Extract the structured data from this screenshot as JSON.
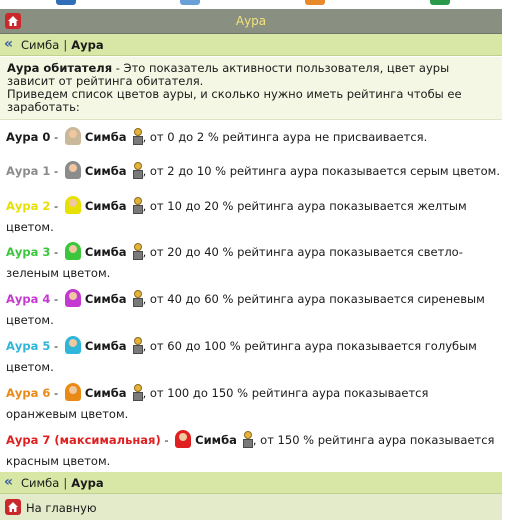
{
  "header": {
    "title": "Аура"
  },
  "breadcrumb": {
    "parent": "Симба",
    "separator": "|",
    "current": "Аура"
  },
  "intro": {
    "term": "Аура обитателя",
    "definition": " - Это показатель активности пользователя, цвет ауры зависит от рейтинга обитателя.",
    "lead": "Приведем список цветов ауры, и сколько нужно иметь рейтинга чтобы ее заработать:"
  },
  "user": {
    "name": "Симба"
  },
  "levels": [
    {
      "label": "Аура 0",
      "color": "#1a1a1a",
      "line1": ", от 0 до 2 % рейтинга аура не присваивается.",
      "line2": ""
    },
    {
      "label": "Аура 1",
      "color": "#8c8c8c",
      "line1": ", от 2 до 10 % рейтинга аура показывается серым цветом.",
      "line2": ""
    },
    {
      "label": "Аура 2",
      "color": "#e8e000",
      "line1": ", от 10 до 20 % рейтинга аура показывается желтым",
      "line2": "цветом."
    },
    {
      "label": "Аура 3",
      "color": "#3cc63c",
      "line1": ", от 20 до 40 % рейтинга аура показывается светло-",
      "line2": "зеленым цветом."
    },
    {
      "label": "Аура 4",
      "color": "#c43ad0",
      "line1": ", от 40 до 60 % рейтинга аура показывается сиреневым",
      "line2": "цветом."
    },
    {
      "label": "Аура 5",
      "color": "#2fb6d8",
      "line1": ", от 60 до 100 % рейтинга аура показывается голубым",
      "line2": "цветом."
    },
    {
      "label": "Аура 6",
      "color": "#ea8a16",
      "line1": ", от 100 до 150 % рейтинга аура показывается",
      "line2": "оранжевым цветом."
    },
    {
      "label": "Аура 7 (максимальная)",
      "color": "#e02020",
      "line1": ", от 150 % рейтинга аура показывается",
      "line2": "красным цветом."
    }
  ],
  "footer": {
    "home_label": "На главную"
  },
  "icons": {
    "home": "home-icon",
    "back": "double-chevron-left-icon",
    "avatar": "avatar-icon",
    "rank": "rank-badge-icon"
  },
  "colors": {
    "titlebar": "#8a9081",
    "title_text": "#f3e37a",
    "breadcrumb_bg": "#d8e6a6",
    "intro_bg": "#f3f7e3",
    "home_red": "#c9282d",
    "link_blue": "#3a5fa8"
  }
}
